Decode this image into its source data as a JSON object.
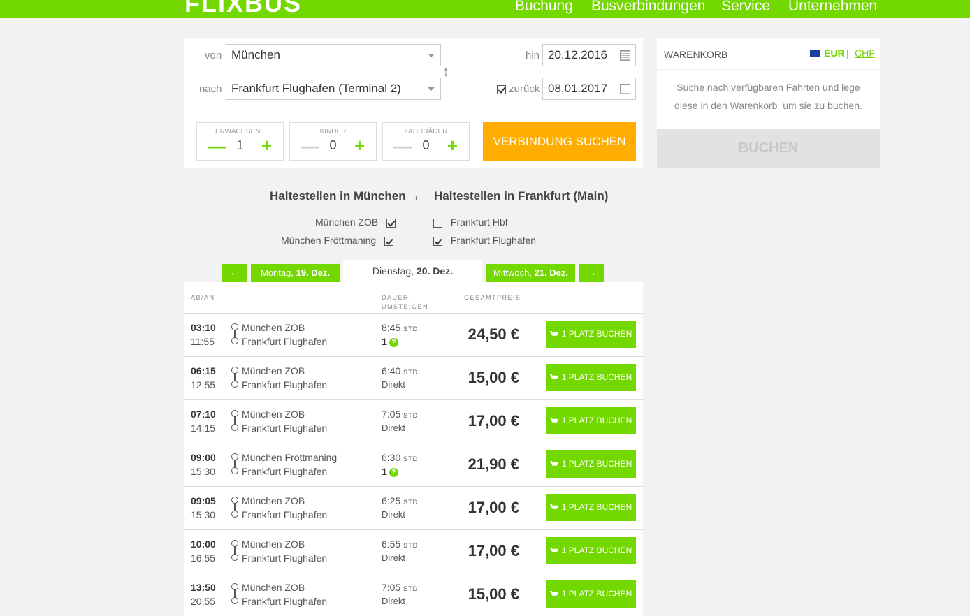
{
  "header": {
    "logo": "FLIXBUS",
    "nav": [
      "Buchung",
      "Busverbindungen",
      "Service",
      "Unternehmen"
    ]
  },
  "search": {
    "from_label": "von",
    "from_value": "München",
    "to_label": "nach",
    "to_value": "Frankfurt Flughafen (Terminal 2)",
    "outbound_label": "hin",
    "outbound_date": "20.12.2016",
    "return_label": "zurück",
    "return_checked": true,
    "return_date": "08.01.2017",
    "adults_label": "ERWACHSENE",
    "adults": "1",
    "children_label": "KINDER",
    "children": "0",
    "bikes_label": "FAHRRÄDER",
    "bikes": "0",
    "submit_label": "VERBINDUNG SUCHEN",
    "minus": "—",
    "plus": "+"
  },
  "cart": {
    "title": "WARENKORB",
    "currency_active": "EUR",
    "currency_sep": "|",
    "currency_alt": "CHF",
    "text": "Suche nach verfügbaren Fahrten und lege diese in den Warenkorb, um sie zu buchen.",
    "book_label": "BUCHEN"
  },
  "stops": {
    "from_heading": "Haltestellen in München",
    "arrow": "→",
    "to_heading": "Haltestellen in Frankfurt (Main)",
    "from": [
      {
        "name": "München ZOB",
        "checked": true
      },
      {
        "name": "München Fröttmaning",
        "checked": true
      }
    ],
    "to": [
      {
        "name": "Frankfurt Hbf",
        "checked": false
      },
      {
        "name": "Frankfurt Flughafen",
        "checked": true
      }
    ]
  },
  "days": {
    "prev_arrow": "←",
    "next_arrow": "→",
    "prev_day": "Montag,",
    "prev_date": "19. Dez.",
    "cur_day": "Dienstag,",
    "cur_date": "20. Dez.",
    "next_day": "Mittwoch,",
    "next_date": "21. Dez."
  },
  "table": {
    "col_time": "AB/AN",
    "col_duration": "DAUER,\nUMSTEIGEN",
    "col_price": "GESAMTPREIS",
    "unit": "STD.",
    "direct": "Direkt",
    "book_label": "1 PLATZ BUCHEN",
    "rows": [
      {
        "dep": "03:10",
        "arr": "11:55",
        "from": "München ZOB",
        "to": "Frankfurt Flughafen",
        "duration": "8:45",
        "changes": "1",
        "price": "24,50 €"
      },
      {
        "dep": "06:15",
        "arr": "12:55",
        "from": "München ZOB",
        "to": "Frankfurt Flughafen",
        "duration": "6:40",
        "changes": "Direkt",
        "price": "15,00 €"
      },
      {
        "dep": "07:10",
        "arr": "14:15",
        "from": "München ZOB",
        "to": "Frankfurt Flughafen",
        "duration": "7:05",
        "changes": "Direkt",
        "price": "17,00 €"
      },
      {
        "dep": "09:00",
        "arr": "15:30",
        "from": "München Fröttmaning",
        "to": "Frankfurt Flughafen",
        "duration": "6:30",
        "changes": "1",
        "price": "21,90 €"
      },
      {
        "dep": "09:05",
        "arr": "15:30",
        "from": "München ZOB",
        "to": "Frankfurt Flughafen",
        "duration": "6:25",
        "changes": "Direkt",
        "price": "17,00 €"
      },
      {
        "dep": "10:00",
        "arr": "16:55",
        "from": "München ZOB",
        "to": "Frankfurt Flughafen",
        "duration": "6:55",
        "changes": "Direkt",
        "price": "17,00 €"
      },
      {
        "dep": "13:50",
        "arr": "20:55",
        "from": "München ZOB",
        "to": "Frankfurt Flughafen",
        "duration": "7:05",
        "changes": "Direkt",
        "price": "15,00 €"
      }
    ]
  }
}
